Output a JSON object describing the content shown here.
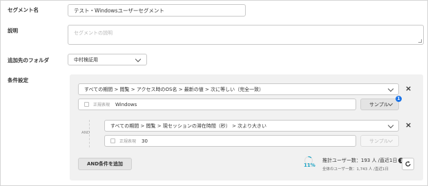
{
  "form": {
    "segment_name_label": "セグメント名",
    "segment_name_value": "テスト・Windowsユーザーセグメント",
    "description_label": "説明",
    "description_placeholder": "セグメントの説明",
    "folder_label": "追加先のフォルダ",
    "folder_value": "中村検証用",
    "conditions_label": "条件設定"
  },
  "conditions": {
    "condition1": {
      "path": "すべての期間 > 閲覧 > アクセス時のOS名 > 最新の値 > 次に等しい（完全一致）",
      "regex_label": "正規表現",
      "value": "Windows",
      "sample_label": "サンプル",
      "sample_badge": "1",
      "remove": "×"
    },
    "and_label": "AND",
    "condition2": {
      "path": "すべての期間 > 閲覧 > 現セッションの滞在時間（秒） > 次より大きい",
      "regex_label": "正規表現",
      "value": "30",
      "sample_label": "サンプル",
      "remove": "×"
    },
    "add_and_label": "AND条件を追加"
  },
  "stats": {
    "percent": "11%",
    "percent_value": 0.11,
    "estimate": "推計ユーザー数：193 人 /直近1日",
    "total": "全体のユーザー数：1,743 人 /直近1日",
    "help": "?"
  },
  "colors": {
    "accent": "#1a73e8",
    "progress": "#1aa3c4",
    "panel_bg": "#f1f1f1"
  }
}
